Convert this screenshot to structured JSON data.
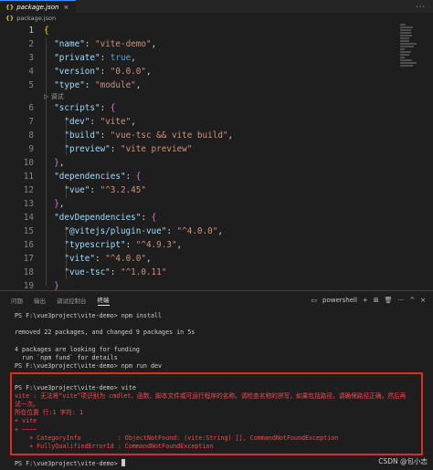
{
  "tabbar": {
    "tab_icon": "{}",
    "tab_title": "package.json",
    "close_glyph": "×",
    "actions_glyph": "···"
  },
  "breadcrumb": {
    "icon": "{}",
    "file": "package.json"
  },
  "editor": {
    "debug_lens": "▷ 调试",
    "lines": [
      {
        "n": "1",
        "tokens": [
          [
            "b1",
            "{"
          ]
        ]
      },
      {
        "n": "2",
        "tokens": [
          [
            "pun",
            "  "
          ],
          [
            "key",
            "\"name\""
          ],
          [
            "pun",
            ": "
          ],
          [
            "str",
            "\"vite-demo\""
          ],
          [
            "pun",
            ","
          ]
        ]
      },
      {
        "n": "3",
        "tokens": [
          [
            "pun",
            "  "
          ],
          [
            "key",
            "\"private\""
          ],
          [
            "pun",
            ": "
          ],
          [
            "kw",
            "true"
          ],
          [
            "pun",
            ","
          ]
        ]
      },
      {
        "n": "4",
        "tokens": [
          [
            "pun",
            "  "
          ],
          [
            "key",
            "\"version\""
          ],
          [
            "pun",
            ": "
          ],
          [
            "str",
            "\"0.0.0\""
          ],
          [
            "pun",
            ","
          ]
        ]
      },
      {
        "n": "5",
        "tokens": [
          [
            "pun",
            "  "
          ],
          [
            "key",
            "\"type\""
          ],
          [
            "pun",
            ": "
          ],
          [
            "str",
            "\"module\""
          ],
          [
            "pun",
            ","
          ]
        ]
      },
      {
        "n": "6",
        "tokens": [
          [
            "pun",
            "  "
          ],
          [
            "key",
            "\"scripts\""
          ],
          [
            "pun",
            ": "
          ],
          [
            "b2",
            "{"
          ]
        ]
      },
      {
        "n": "7",
        "tokens": [
          [
            "pun",
            "    "
          ],
          [
            "key",
            "\"dev\""
          ],
          [
            "pun",
            ": "
          ],
          [
            "str",
            "\"vite\""
          ],
          [
            "pun",
            ","
          ]
        ]
      },
      {
        "n": "8",
        "tokens": [
          [
            "pun",
            "    "
          ],
          [
            "key",
            "\"build\""
          ],
          [
            "pun",
            ": "
          ],
          [
            "str",
            "\"vue-tsc && vite build\""
          ],
          [
            "pun",
            ","
          ]
        ]
      },
      {
        "n": "9",
        "tokens": [
          [
            "pun",
            "    "
          ],
          [
            "key",
            "\"preview\""
          ],
          [
            "pun",
            ": "
          ],
          [
            "str",
            "\"vite preview\""
          ]
        ]
      },
      {
        "n": "10",
        "tokens": [
          [
            "pun",
            "  "
          ],
          [
            "b2",
            "}"
          ],
          [
            "pun",
            ","
          ]
        ]
      },
      {
        "n": "11",
        "tokens": [
          [
            "pun",
            "  "
          ],
          [
            "key",
            "\"dependencies\""
          ],
          [
            "pun",
            ": "
          ],
          [
            "b2",
            "{"
          ]
        ]
      },
      {
        "n": "12",
        "tokens": [
          [
            "pun",
            "    "
          ],
          [
            "key",
            "\"vue\""
          ],
          [
            "pun",
            ": "
          ],
          [
            "str",
            "\"^3.2.45\""
          ]
        ]
      },
      {
        "n": "13",
        "tokens": [
          [
            "pun",
            "  "
          ],
          [
            "b2",
            "}"
          ],
          [
            "pun",
            ","
          ]
        ]
      },
      {
        "n": "14",
        "tokens": [
          [
            "pun",
            "  "
          ],
          [
            "key",
            "\"devDependencies\""
          ],
          [
            "pun",
            ": "
          ],
          [
            "b2",
            "{"
          ]
        ]
      },
      {
        "n": "15",
        "tokens": [
          [
            "pun",
            "    "
          ],
          [
            "key",
            "\"@vitejs/plugin-vue\""
          ],
          [
            "pun",
            ": "
          ],
          [
            "str",
            "\"^4.0.0\""
          ],
          [
            "pun",
            ","
          ]
        ]
      },
      {
        "n": "16",
        "tokens": [
          [
            "pun",
            "    "
          ],
          [
            "key",
            "\"typescript\""
          ],
          [
            "pun",
            ": "
          ],
          [
            "str",
            "\"^4.9.3\""
          ],
          [
            "pun",
            ","
          ]
        ]
      },
      {
        "n": "17",
        "tokens": [
          [
            "pun",
            "    "
          ],
          [
            "key",
            "\"vite\""
          ],
          [
            "pun",
            ": "
          ],
          [
            "str",
            "\"^4.0.0\""
          ],
          [
            "pun",
            ","
          ]
        ]
      },
      {
        "n": "18",
        "tokens": [
          [
            "pun",
            "    "
          ],
          [
            "key",
            "\"vue-tsc\""
          ],
          [
            "pun",
            ": "
          ],
          [
            "str",
            "\"^1.0.11\""
          ]
        ]
      },
      {
        "n": "19",
        "tokens": [
          [
            "pun",
            "  "
          ],
          [
            "b2",
            "}"
          ]
        ]
      },
      {
        "n": "20",
        "tokens": [
          [
            "b1",
            "}"
          ]
        ]
      }
    ]
  },
  "panel": {
    "tabs": [
      "问题",
      "输出",
      "调试控制台",
      "终端"
    ],
    "active_tab": "终端",
    "shell_label": "powershell",
    "add_glyph": "+",
    "split_glyph": "⊞",
    "trash_glyph": "🗑",
    "more_glyph": "···",
    "maximize_glyph": "^",
    "close_glyph": "×"
  },
  "terminal": {
    "lines": [
      {
        "cls": "",
        "text": "PS F:\\vue3project\\vite-demo> npm install"
      },
      {
        "cls": "",
        "text": ""
      },
      {
        "cls": "",
        "text": "removed 22 packages, and changed 9 packages in 5s"
      },
      {
        "cls": "",
        "text": ""
      },
      {
        "cls": "",
        "text": "4 packages are looking for funding"
      },
      {
        "cls": "",
        "text": "  run `npm fund` for details"
      },
      {
        "cls": "",
        "text": "PS F:\\vue3project\\vite-demo> npm run dev"
      },
      {
        "cls": "",
        "text": ""
      },
      {
        "cls": "",
        "text": "PS F:\\vue3project\\vite-demo> vite"
      },
      {
        "cls": "err",
        "text": "vite : 无法将“vite”项识别为 cmdlet、函数、脚本文件或可运行程序的名称。请检查名称的拼写，如果包括路径，请确保路径正确，然后再"
      },
      {
        "cls": "err",
        "text": "试一次。"
      },
      {
        "cls": "err",
        "text": "所在位置 行:1 字符: 1"
      },
      {
        "cls": "err",
        "text": "+ vite"
      },
      {
        "cls": "err",
        "text": "+ ~~~~"
      },
      {
        "cls": "err",
        "text": "    + CategoryInfo          : ObjectNotFound: (vite:String) [], CommandNotFoundException"
      },
      {
        "cls": "err",
        "text": "    + FullyQualifiedErrorId : CommandNotFoundException"
      },
      {
        "cls": "",
        "text": ""
      },
      {
        "cls": "",
        "text": "PS F:\\vue3project\\vite-demo> "
      }
    ]
  },
  "watermark": "CSDN @包小志"
}
